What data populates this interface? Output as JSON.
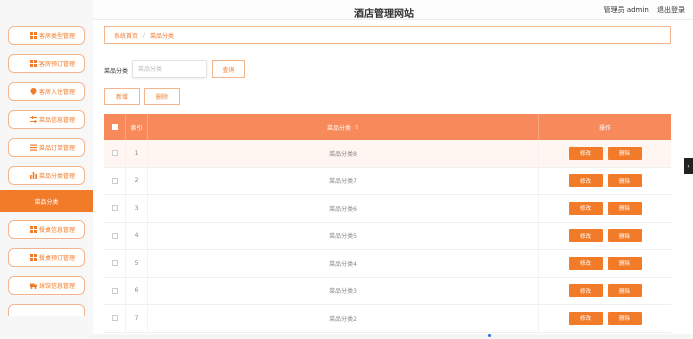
{
  "header": {
    "site_title": "酒店管理网站",
    "user_label": "管理员 admin",
    "logout_label": "退出登录"
  },
  "sidebar": {
    "items": [
      {
        "label": "客房类型管理",
        "icon": "grid-icon"
      },
      {
        "label": "客房预订管理",
        "icon": "grid-icon"
      },
      {
        "label": "客房入住管理",
        "icon": "location-pin-icon"
      },
      {
        "label": "菜品信息管理",
        "icon": "sliders-icon"
      },
      {
        "label": "菜品订单管理",
        "icon": "list-icon"
      },
      {
        "label": "菜品分类管理",
        "icon": "bar-chart-icon"
      }
    ],
    "active_sub_item": "菜品分类",
    "items_after": [
      {
        "label": "餐桌信息管理",
        "icon": "grid-icon"
      },
      {
        "label": "餐桌预订管理",
        "icon": "grid-icon"
      },
      {
        "label": "球馆信息管理",
        "icon": "truck-icon"
      }
    ]
  },
  "breadcrumb": {
    "home": "系统首页",
    "separator": "/",
    "current": "菜品分类"
  },
  "search": {
    "label": "菜品分类",
    "placeholder": "菜品分类",
    "button": "查询"
  },
  "actions": {
    "add": "新增",
    "delete": "删除"
  },
  "table": {
    "columns": {
      "index": "索引",
      "name": "菜品分类",
      "ops": "操作"
    },
    "edit_label": "修改",
    "delete_label": "删除",
    "rows": [
      {
        "index": "1",
        "name": "菜品分类8"
      },
      {
        "index": "2",
        "name": "菜品分类7"
      },
      {
        "index": "3",
        "name": "菜品分类6"
      },
      {
        "index": "4",
        "name": "菜品分类5"
      },
      {
        "index": "5",
        "name": "菜品分类4"
      },
      {
        "index": "6",
        "name": "菜品分类3"
      },
      {
        "index": "7",
        "name": "菜品分类2"
      }
    ]
  },
  "colors": {
    "accent": "#f27b2a",
    "table_header": "#f7895a"
  }
}
